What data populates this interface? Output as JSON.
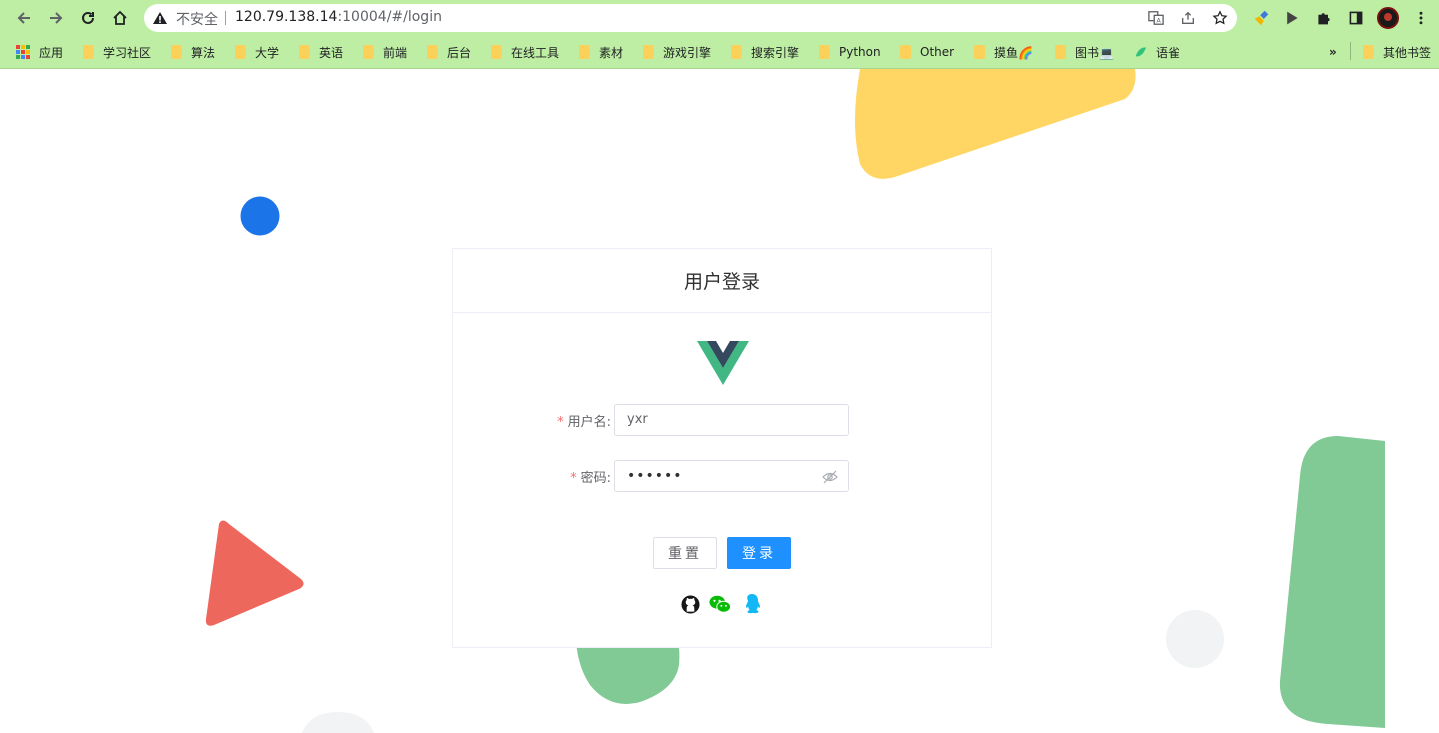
{
  "browser": {
    "security_label": "不安全",
    "url_host": "120.79.138.14",
    "url_rest": ":10004/#/login",
    "bookmarks": [
      {
        "label": "应用",
        "type": "apps"
      },
      {
        "label": "学习社区",
        "type": "folder"
      },
      {
        "label": "算法",
        "type": "folder"
      },
      {
        "label": "大学",
        "type": "folder"
      },
      {
        "label": "英语",
        "type": "folder"
      },
      {
        "label": "前端",
        "type": "folder"
      },
      {
        "label": "后台",
        "type": "folder"
      },
      {
        "label": "在线工具",
        "type": "folder"
      },
      {
        "label": "素材",
        "type": "folder"
      },
      {
        "label": "游戏引擎",
        "type": "folder"
      },
      {
        "label": "搜索引擎",
        "type": "folder"
      },
      {
        "label": "Python",
        "type": "folder"
      },
      {
        "label": "Other",
        "type": "folder"
      },
      {
        "label": "摸鱼🌈",
        "type": "folder"
      },
      {
        "label": "图书💻",
        "type": "folder"
      },
      {
        "label": "语雀",
        "type": "link"
      }
    ],
    "overflow_label": "»",
    "other_bookmarks_label": "其他书签"
  },
  "login": {
    "title": "用户登录",
    "username_label": "用户名:",
    "username_value": "yxr",
    "password_label": "密码:",
    "password_value": "••••••",
    "reset_label": "重置",
    "login_label": "登录",
    "social_icons": [
      "github-icon",
      "wechat-icon",
      "qq-icon"
    ]
  },
  "colors": {
    "primary": "#1e90ff",
    "required": "#f56c6c",
    "vue_green": "#41b883",
    "vue_dark": "#34495e",
    "shape_yellow": "#ffd664",
    "shape_blue": "#1b74e8",
    "shape_red": "#ee675c",
    "shape_green": "#81c995",
    "shape_gray": "#f1f3f4"
  }
}
